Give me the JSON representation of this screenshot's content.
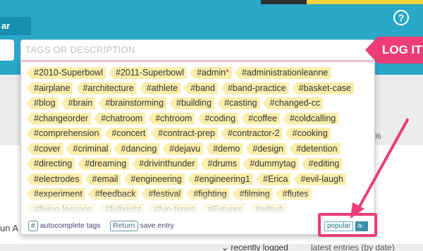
{
  "header": {
    "left_button": "ar",
    "help": "?"
  },
  "search": {
    "placeholder": "TAGS OR DESCRIPTION"
  },
  "login": {
    "label": "LOG IT"
  },
  "background": {
    "card_text": "un A",
    "percent": "%",
    "sort_recent": "⌄ recently logged",
    "sort_latest": "latest entries (by date)"
  },
  "tag_rows": [
    [
      "#2010-Superbowl",
      "#2011-Superbowl",
      "#admin",
      "#administrationleanne"
    ],
    [
      "#airplane",
      "#architecture",
      "#athlete",
      "#band",
      "#band-practice",
      "#basket-case"
    ],
    [
      "#blog",
      "#brain",
      "#brainstorming",
      "#building",
      "#casting",
      "#changed-cc"
    ],
    [
      "#changeorder",
      "#chatroom",
      "#chtroom",
      "#coding",
      "#coffee",
      "#coldcalling"
    ],
    [
      "#comprehension",
      "#concert",
      "#contract-prep",
      "#contractor-2",
      "#cooking"
    ],
    [
      "#cover",
      "#criminal",
      "#dancing",
      "#dejavu",
      "#demo",
      "#design",
      "#detention"
    ],
    [
      "#directing",
      "#dreaming",
      "#drivinthunder",
      "#drums",
      "#dummytag",
      "#editing"
    ],
    [
      "#electrodes",
      "#email",
      "#engineering",
      "#engineering1",
      "#Erica",
      "#evil-laugh"
    ],
    [
      "#experiment",
      "#feedback",
      "#festival",
      "#fighting",
      "#filming",
      "#flutes"
    ],
    [
      "#flying-lessons",
      "#fulbright",
      "#fun-times",
      "#Futures",
      "#github"
    ]
  ],
  "footer": {
    "key_hash": "#",
    "autocomplete_label": "autocomplete tags",
    "key_return": "Return",
    "save_label": "save entry"
  },
  "sort_toggle": {
    "popular": "popular",
    "az": "a-z"
  },
  "colors": {
    "header": "#2aa8c8",
    "accent": "#ec3d78",
    "tag_bg": "#fbeeab"
  }
}
